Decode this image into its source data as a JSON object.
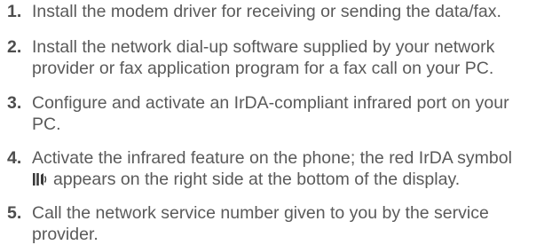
{
  "steps": [
    {
      "number": "1.",
      "lines": [
        "Install the modem driver for receiving or sending the data/fax."
      ]
    },
    {
      "number": "2.",
      "lines": [
        "Install the network dial-up software supplied by your network",
        "provider or fax application program for a fax call on your PC."
      ]
    },
    {
      "number": "3.",
      "lines": [
        "Configure and activate an IrDA-compliant infrared port on your",
        "PC."
      ]
    },
    {
      "number": "4.",
      "lines": [
        "Activate the infrared feature on the phone; the red IrDA symbol",
        "appears on the right side at the bottom of the display."
      ],
      "icon": "irda-symbol-icon"
    },
    {
      "number": "5.",
      "lines": [
        "Call the network service number given to you by the service",
        "provider."
      ]
    }
  ],
  "colors": {
    "text": "#5a5a5a",
    "number": "#4d4d4d"
  }
}
